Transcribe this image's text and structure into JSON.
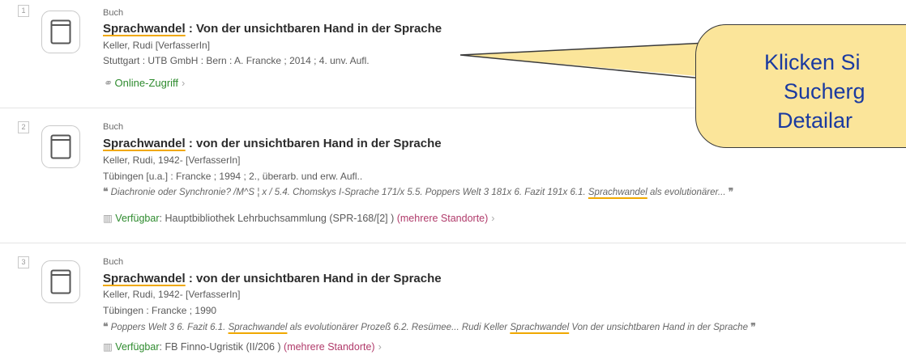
{
  "results": [
    {
      "number": "1",
      "type": "Buch",
      "title_highlight": "Sprachwandel",
      "title_rest": " : Von der unsichtbaren Hand in der Sprache",
      "author": "Keller, Rudi [VerfasserIn]",
      "publication": "Stuttgart : UTB GmbH : Bern : A. Francke ; 2014 ; 4. unv. Aufl.",
      "access_label": "Online-Zugriff"
    },
    {
      "number": "2",
      "type": "Buch",
      "title_highlight": "Sprachwandel",
      "title_rest": " : von der unsichtbaren Hand in der Sprache",
      "author": "Keller, Rudi, 1942- [VerfasserIn]",
      "publication": "Tübingen [u.a.] : Francke ; 1994 ; 2., überarb. und erw. Aufl..",
      "snippet_before": "Diachronie oder Synchronie? /M^S ¦ x / 5.4. Chomskys I-Sprache 171/x 5.5. Poppers Welt 3 181x 6. Fazit 191x 6.1. ",
      "snippet_highlight": "Sprachwandel",
      "snippet_after": " als evolutionärer...",
      "availability_label": "Verfügbar",
      "availability_location": ": Hauptbibliothek Lehrbuchsammlung   (SPR-168/[2] ) ",
      "more_locations": "(mehrere Standorte)"
    },
    {
      "number": "3",
      "type": "Buch",
      "title_highlight": "Sprachwandel",
      "title_rest": " : von der unsichtbaren Hand in der Sprache",
      "author": "Keller, Rudi, 1942- [VerfasserIn]",
      "publication": "Tübingen : Francke ; 1990",
      "snippet_before": "Poppers Welt 3 6. Fazit 6.1. ",
      "snippet_highlight": "Sprachwandel",
      "snippet_middle": " als evolutionärer Prozeß 6.2. Resümee... Rudi Keller ",
      "snippet_highlight2": "Sprachwandel",
      "snippet_after": " Von der unsichtbaren Hand in der Sprache",
      "availability_label": "Verfügbar",
      "availability_location": ": FB Finno-Ugristik  (II/206 ) ",
      "more_locations": "(mehrere Standorte)"
    }
  ],
  "callout": {
    "line1": "Klicken Si",
    "line2": "Sucherg",
    "line3": "Detailar"
  },
  "icons": {
    "book": "book-icon",
    "link": "link-icon",
    "library": "library-icon",
    "quote_open": "❝",
    "quote_close": "❞",
    "chevron": "›"
  },
  "colors": {
    "highlight_underline": "#f0a800",
    "link_green": "#2e8b2e",
    "more_locations": "#b03a6a",
    "callout_bg": "#fbe59a",
    "callout_text": "#1a3aa0"
  }
}
